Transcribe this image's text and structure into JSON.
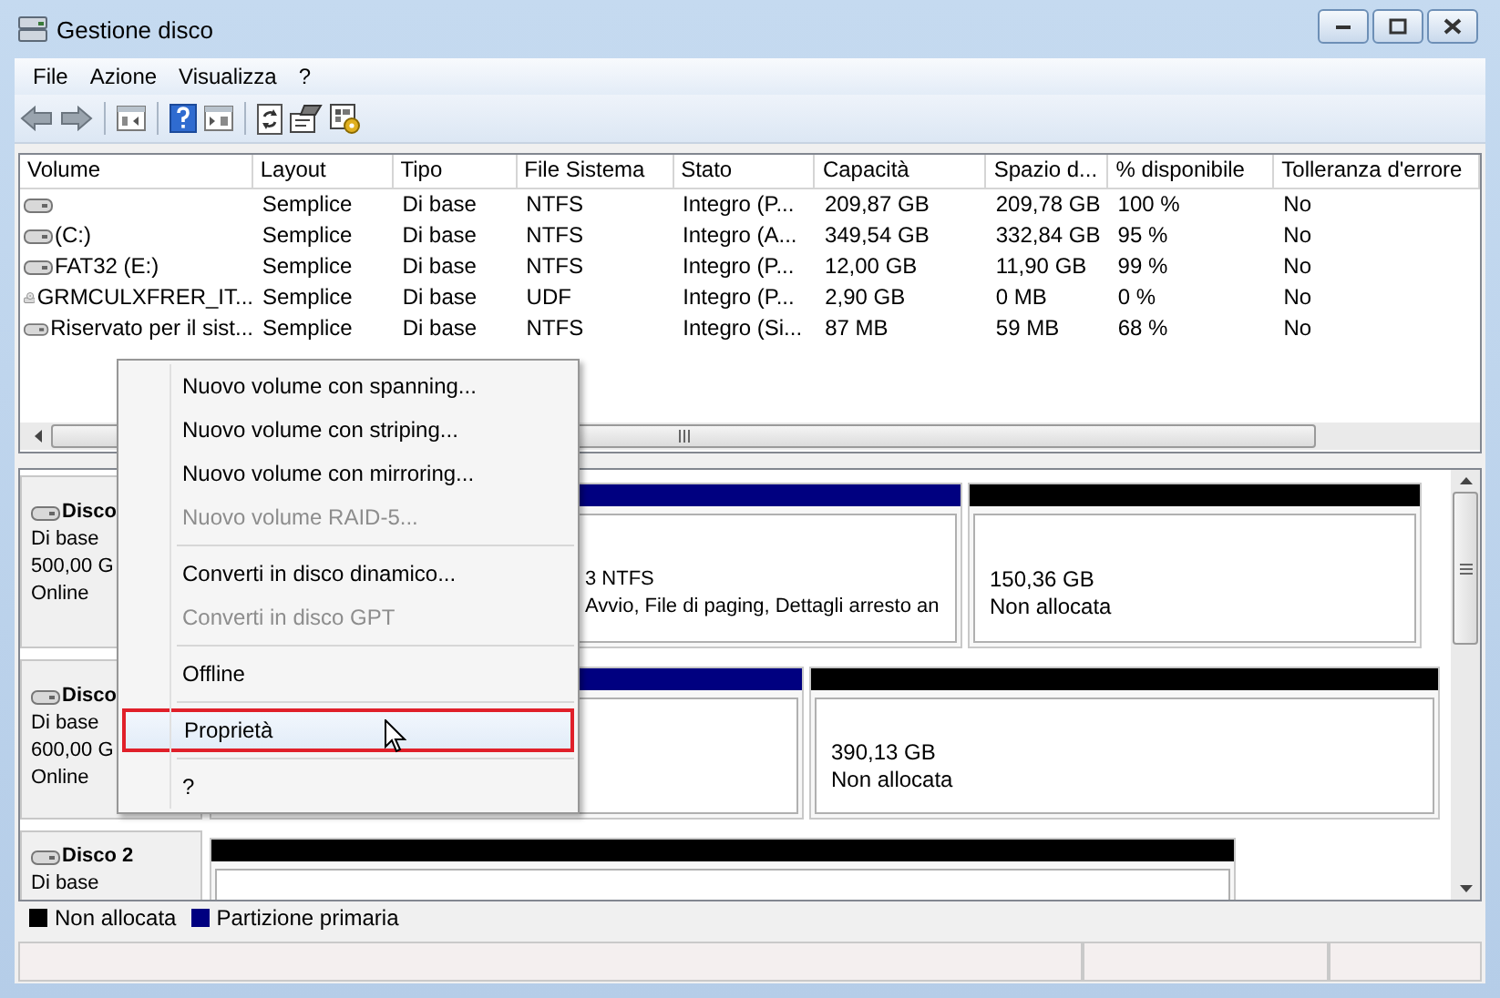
{
  "window": {
    "title": "Gestione disco"
  },
  "menu_bar": [
    "File",
    "Azione",
    "Visualizza",
    "?"
  ],
  "volume_table": {
    "columns": [
      "Volume",
      "Layout",
      "Tipo",
      "File Sistema",
      "Stato",
      "Capacità",
      "Spazio d...",
      "% disponibile",
      "Tolleranza d'errore"
    ],
    "rows": [
      {
        "kind": "disk",
        "cells": [
          "",
          "Semplice",
          "Di base",
          "NTFS",
          "Integro (P...",
          "209,87 GB",
          "209,78 GB",
          "100 %",
          "No"
        ]
      },
      {
        "kind": "disk",
        "cells": [
          " (C:)",
          "Semplice",
          "Di base",
          "NTFS",
          "Integro (A...",
          "349,54 GB",
          "332,84 GB",
          "95 %",
          "No"
        ]
      },
      {
        "kind": "disk",
        "cells": [
          "FAT32 (E:)",
          "Semplice",
          "Di base",
          "NTFS",
          "Integro (P...",
          "12,00 GB",
          "11,90 GB",
          "99 %",
          "No"
        ]
      },
      {
        "kind": "optical",
        "cells": [
          "GRMCULXFRER_IT...",
          "Semplice",
          "Di base",
          "UDF",
          "Integro (P...",
          "2,90 GB",
          "0 MB",
          "0 %",
          "No"
        ]
      },
      {
        "kind": "disk",
        "cells": [
          "Riservato per il sist...",
          "Semplice",
          "Di base",
          "NTFS",
          "Integro (Si...",
          "87 MB",
          "59 MB",
          "68 %",
          "No"
        ]
      }
    ]
  },
  "disks": [
    {
      "name": "Disco",
      "lines": [
        "Di base",
        "500,00 G",
        "Online"
      ],
      "partitions": [
        {
          "color": "#000080",
          "lines": [
            "3 NTFS",
            "Avvio, File di paging, Dettagli arresto an"
          ]
        },
        {
          "color": "#000000",
          "lines": [
            "150,36 GB",
            "Non allocata"
          ]
        }
      ]
    },
    {
      "name": "Disco",
      "lines": [
        "Di base",
        "600,00 G",
        "Online"
      ],
      "partitions": [
        {
          "color": "#000080"
        },
        {
          "color": "#000000",
          "lines": [
            "390,13 GB",
            "Non allocata"
          ]
        }
      ]
    },
    {
      "name": "Disco 2",
      "lines": [
        "Di base"
      ],
      "partitions": [
        {
          "color": "#000000"
        }
      ]
    }
  ],
  "legend": [
    {
      "label": "Non allocata",
      "color": "#000000"
    },
    {
      "label": "Partizione primaria",
      "color": "#000080"
    }
  ],
  "context_menu": {
    "items": [
      {
        "kind": "item",
        "label": "Nuovo volume con spanning...",
        "disabled": false,
        "selected": false
      },
      {
        "kind": "item",
        "label": "Nuovo volume con striping...",
        "disabled": false,
        "selected": false
      },
      {
        "kind": "item",
        "label": "Nuovo volume con mirroring...",
        "disabled": false,
        "selected": false
      },
      {
        "kind": "item",
        "label": "Nuovo volume RAID-5...",
        "disabled": true,
        "selected": false
      },
      {
        "kind": "separator"
      },
      {
        "kind": "item",
        "label": "Converti in disco dinamico...",
        "disabled": false,
        "selected": false
      },
      {
        "kind": "item",
        "label": "Converti in disco GPT",
        "disabled": true,
        "selected": false
      },
      {
        "kind": "separator"
      },
      {
        "kind": "item",
        "label": "Offline",
        "disabled": false,
        "selected": false
      },
      {
        "kind": "separator"
      },
      {
        "kind": "item",
        "label": "Proprietà",
        "disabled": false,
        "selected": true
      },
      {
        "kind": "separator"
      },
      {
        "kind": "item",
        "label": "?",
        "disabled": false,
        "selected": false
      }
    ]
  }
}
